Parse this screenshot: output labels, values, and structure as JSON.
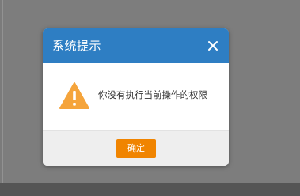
{
  "dialog": {
    "title": "系统提示",
    "close_icon": "close-icon",
    "message": "你没有执行当前操作的权限",
    "icon": "warning-icon",
    "ok_label": "确定"
  },
  "colors": {
    "header": "#2e7ec3",
    "warning": "#f5a43b",
    "button": "#f08400",
    "backdrop": "#7d7d7d"
  }
}
